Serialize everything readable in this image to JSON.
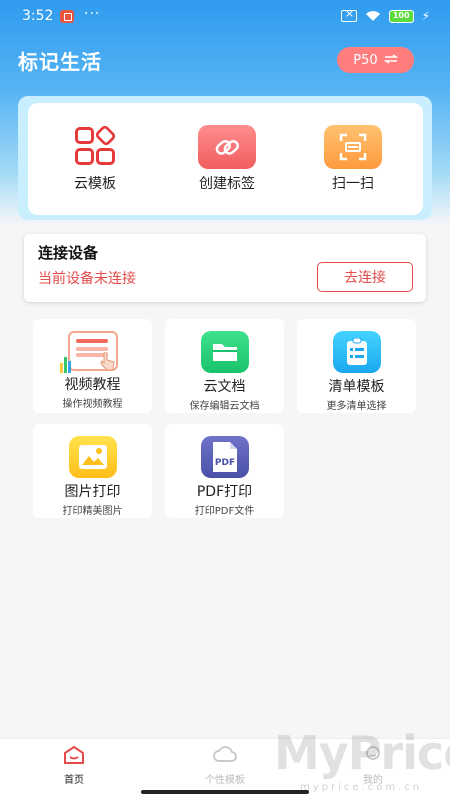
{
  "status_bar": {
    "time": "3:52",
    "dots": "···",
    "battery": "100"
  },
  "header": {
    "title": "标记生活",
    "device_label": "P50"
  },
  "quick_actions": [
    {
      "label": "云模板",
      "icon": "cloud-template-icon"
    },
    {
      "label": "创建标签",
      "icon": "link-icon"
    },
    {
      "label": "扫一扫",
      "icon": "scan-icon"
    }
  ],
  "connection": {
    "title": "连接设备",
    "status": "当前设备未连接",
    "button": "去连接"
  },
  "features": [
    {
      "title": "视频教程",
      "subtitle": "操作视频教程",
      "icon": "video-tutorial-icon"
    },
    {
      "title": "云文档",
      "subtitle": "保存编辑云文档",
      "icon": "folder-icon"
    },
    {
      "title": "清单模板",
      "subtitle": "更多清单选择",
      "icon": "checklist-icon"
    },
    {
      "title": "图片打印",
      "subtitle": "打印精美图片",
      "icon": "image-icon"
    },
    {
      "title": "PDF打印",
      "subtitle": "打印PDF文件",
      "icon": "pdf-icon",
      "badge": "PDF"
    }
  ],
  "tabs": [
    {
      "label": "首页",
      "active": true
    },
    {
      "label": "个性模板",
      "active": false
    },
    {
      "label": "我的",
      "active": false
    }
  ],
  "watermark": {
    "text": "MyPrice",
    "sub": "myprice.com.cn"
  },
  "colors": {
    "primary_blue": "#2f9bf0",
    "accent_red": "#e54b4b",
    "device_pill": "#ff7d7d"
  }
}
